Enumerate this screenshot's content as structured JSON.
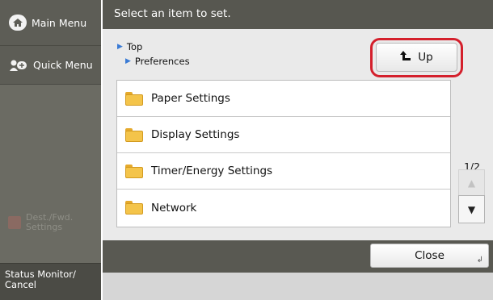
{
  "sidebar": {
    "main_menu_label": "Main Menu",
    "quick_menu_label": "Quick Menu",
    "dest_label": "Dest./Fwd.\nSettings",
    "status_label": "Status Monitor/\nCancel"
  },
  "header": {
    "title": "Select an item to set."
  },
  "breadcrumb": {
    "level1": "Top",
    "level2": "Preferences"
  },
  "up_button": {
    "label": "Up"
  },
  "list": {
    "items": [
      {
        "label": "Paper Settings"
      },
      {
        "label": "Display Settings"
      },
      {
        "label": "Timer/Energy Settings"
      },
      {
        "label": "Network"
      }
    ]
  },
  "pager": {
    "indicator": "1/2"
  },
  "footer": {
    "close_label": "Close"
  },
  "colors": {
    "highlight": "#d4202c",
    "header_bg": "#575750",
    "folder": "#f4c44a"
  },
  "icons": {
    "main_menu": "home-icon",
    "quick_menu": "quick-menu-icon",
    "up": "up-arrow-icon",
    "folder": "folder-icon",
    "scroll_up": "triangle-up-icon",
    "scroll_down": "triangle-down-icon",
    "close_enter": "enter-icon"
  }
}
